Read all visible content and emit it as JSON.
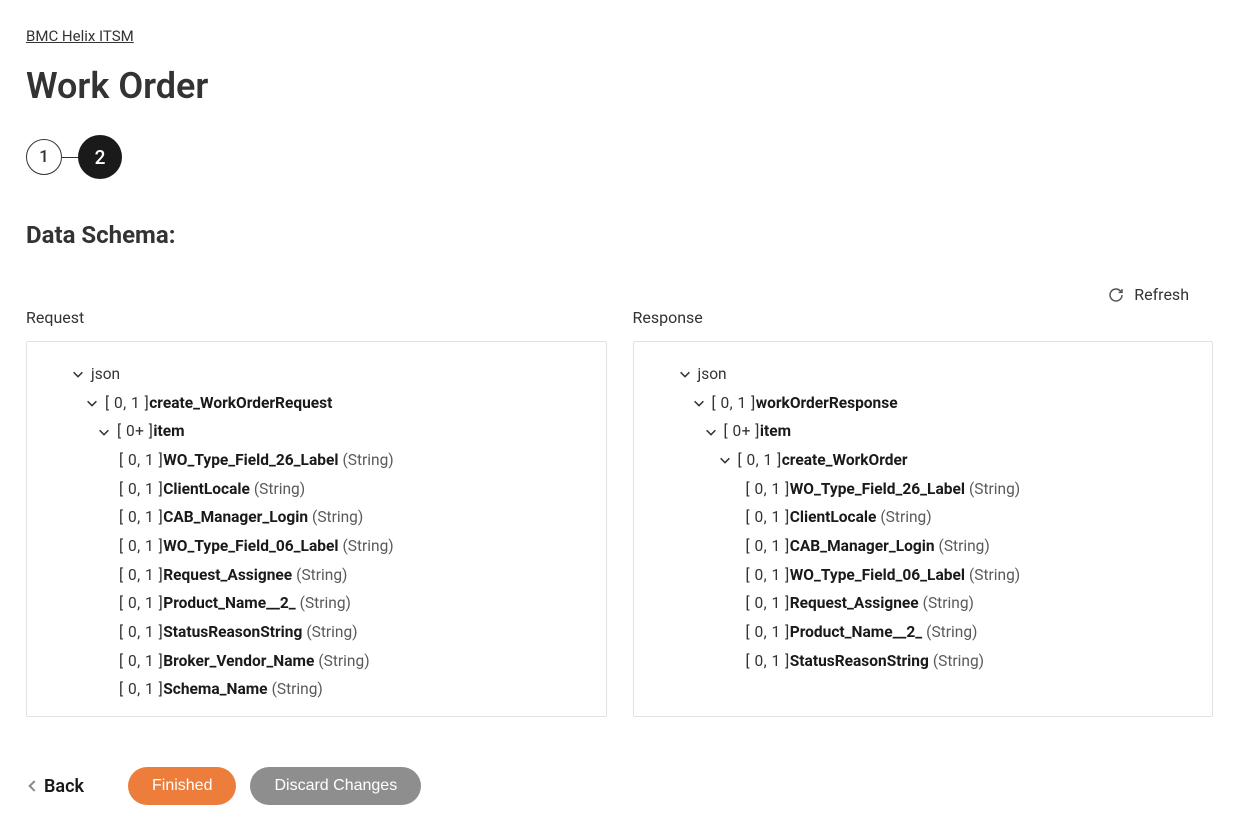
{
  "breadcrumb": "BMC Helix ITSM",
  "page_title": "Work Order",
  "stepper": {
    "step1": "1",
    "step2": "2"
  },
  "section": "Data Schema:",
  "refresh": "Refresh",
  "columns": {
    "request": "Request",
    "response": "Response"
  },
  "labels": {
    "json": "json",
    "card01": "[ 0, 1 ] ",
    "card0p": "[ 0+ ] ",
    "item": "item",
    "type_string": "(String)"
  },
  "request_root": "create_WorkOrderRequest",
  "request_fields": [
    "WO_Type_Field_26_Label",
    "ClientLocale",
    "CAB_Manager_Login",
    "WO_Type_Field_06_Label",
    "Request_Assignee",
    "Product_Name__2_",
    "StatusReasonString",
    "Broker_Vendor_Name",
    "Schema_Name"
  ],
  "response_root": "workOrderResponse",
  "response_sub": "create_WorkOrder",
  "response_fields": [
    "WO_Type_Field_26_Label",
    "ClientLocale",
    "CAB_Manager_Login",
    "WO_Type_Field_06_Label",
    "Request_Assignee",
    "Product_Name__2_",
    "StatusReasonString"
  ],
  "footer": {
    "back": "Back",
    "finished": "Finished",
    "discard": "Discard Changes"
  }
}
